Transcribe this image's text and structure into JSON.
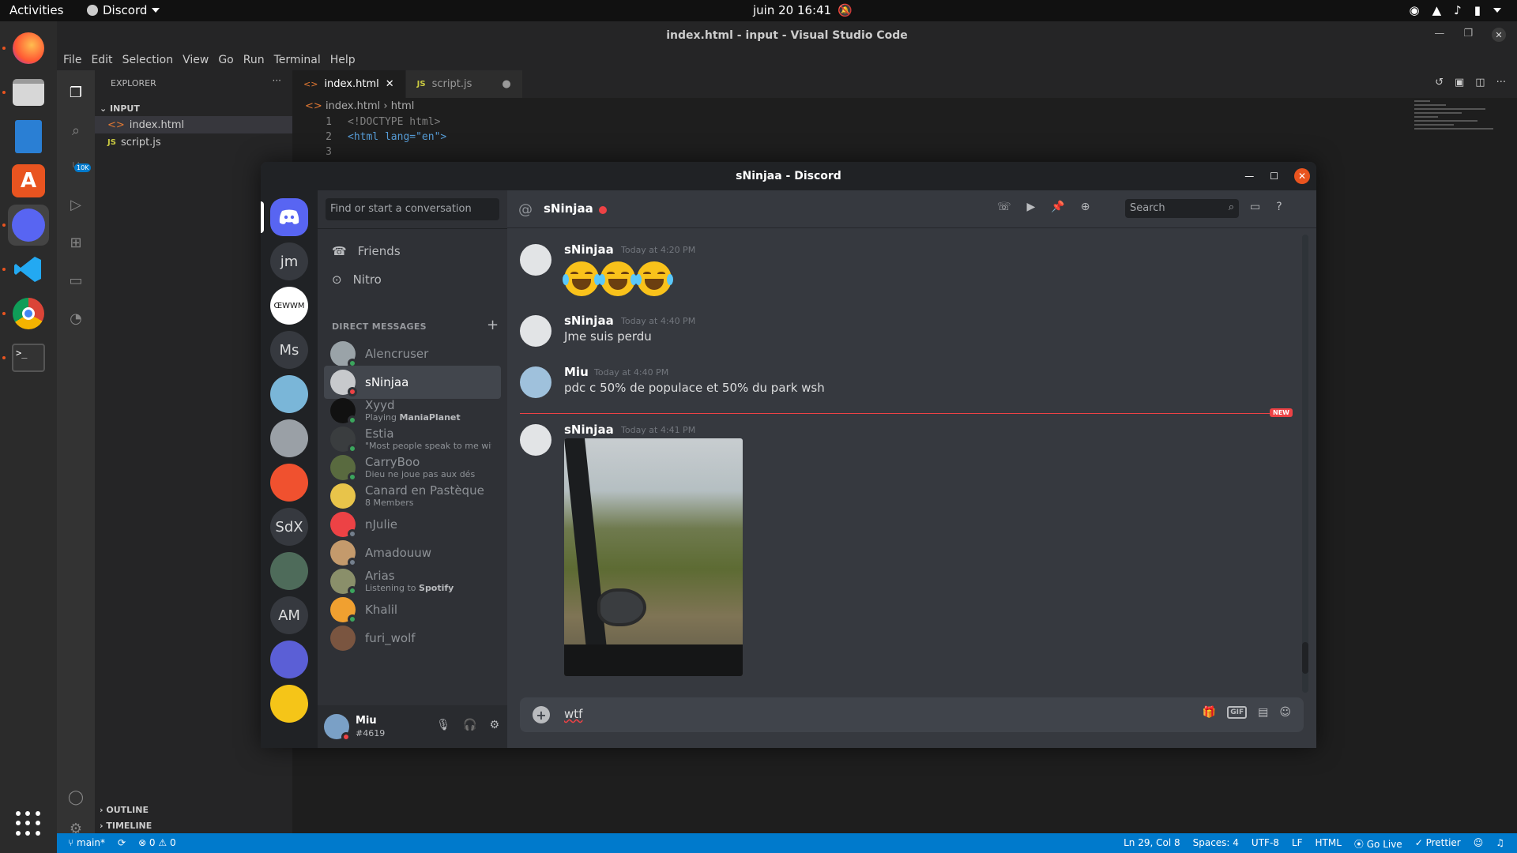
{
  "topbar": {
    "activities": "Activities",
    "app_name": "Discord",
    "clock": "juin 20  16:41"
  },
  "dock": {
    "apps": [
      "Firefox",
      "Files",
      "LibreOffice Writer",
      "Ubuntu Software",
      "Discord",
      "Visual Studio Code",
      "Google Chrome",
      "Terminal"
    ],
    "active": "Discord"
  },
  "vscode": {
    "title": "index.html - input - Visual Studio Code",
    "menu": [
      "File",
      "Edit",
      "Selection",
      "View",
      "Go",
      "Run",
      "Terminal",
      "Help"
    ],
    "explorer_label": "EXPLORER",
    "folder": "INPUT",
    "files": [
      "index.html",
      "script.js"
    ],
    "tabs": [
      {
        "label": "index.html",
        "icon": "html-icon",
        "active": true
      },
      {
        "label": "script.js",
        "icon": "js-icon",
        "active": false
      }
    ],
    "breadcrumb": [
      "index.html",
      "html"
    ],
    "code_lines": [
      {
        "num": "1",
        "text": "<!DOCTYPE html>"
      },
      {
        "num": "2",
        "text": "<html lang=\"en\">"
      },
      {
        "num": "3",
        "text": ""
      }
    ],
    "scm_badge": "10K",
    "outline": "OUTLINE",
    "timeline": "TIMELINE",
    "status": {
      "branch": "main*",
      "problems": "⊗ 0 ⚠ 0",
      "position": "Ln 29, Col 8",
      "spaces": "Spaces: 4",
      "encoding": "UTF-8",
      "eol": "LF",
      "language": "HTML",
      "golive": "Go Live",
      "prettier": "Prettier"
    }
  },
  "discord": {
    "window_title": "sNinjaa - Discord",
    "search_placeholder": "Find or start a conversation",
    "nav": [
      {
        "label": "Friends",
        "icon": "friends-icon"
      },
      {
        "label": "Nitro",
        "icon": "nitro-icon"
      }
    ],
    "dm_header": "DIRECT MESSAGES",
    "guilds": [
      "jm",
      "ŒWWM",
      "Ms",
      "",
      "",
      "",
      "SdX",
      "",
      "AM",
      "",
      ""
    ],
    "dms": [
      {
        "name": "Alencruser",
        "sub": "",
        "sub_bold": "",
        "status": "#3ba55d",
        "avatar": "#9aa3a8"
      },
      {
        "name": "sNinjaa",
        "sub": "",
        "sub_bold": "",
        "status": "#ed4245",
        "avatar": "#c7c9cc",
        "selected": true
      },
      {
        "name": "Xyyd",
        "sub": "Playing ",
        "sub_bold": "ManiaPlanet",
        "status": "#3ba55d",
        "avatar": "#111111"
      },
      {
        "name": "Estia",
        "sub": "\"Most people speak to me wit...",
        "sub_bold": "",
        "status": "#3ba55d",
        "avatar": "#3a3d3f"
      },
      {
        "name": "CarryBoo",
        "sub": "Dieu ne joue pas aux dés",
        "sub_bold": "",
        "status": "#3ba55d",
        "avatar": "#596a3f"
      },
      {
        "name": "Canard en Pastèque",
        "sub": "8 Members",
        "sub_bold": "",
        "status": "",
        "avatar": "#e8c44a"
      },
      {
        "name": "nJulie",
        "sub": "",
        "sub_bold": "",
        "status": "#747f8d",
        "avatar": "#ed4245"
      },
      {
        "name": "Amadouuw",
        "sub": "",
        "sub_bold": "",
        "status": "#747f8d",
        "avatar": "#c49a6c"
      },
      {
        "name": "Arias",
        "sub": "Listening to ",
        "sub_bold": "Spotify",
        "status": "#3ba55d",
        "avatar": "#8a8f6a"
      },
      {
        "name": "Khalil",
        "sub": "",
        "sub_bold": "",
        "status": "#3ba55d",
        "avatar": "#f0a030"
      },
      {
        "name": "furi_wolf",
        "sub": "",
        "sub_bold": "",
        "status": "",
        "avatar": "#7a5540"
      }
    ],
    "user": {
      "name": "Miu",
      "tag": "#4619"
    },
    "chat": {
      "recipient": "sNinjaa",
      "search": "Search",
      "messages": [
        {
          "author": "sNinjaa",
          "time": "Today at 4:20 PM",
          "text": "",
          "kind": "emoji",
          "emoji": "😂😂😂"
        },
        {
          "author": "sNinjaa",
          "time": "Today at 4:40 PM",
          "text": "Jme suis perdu",
          "kind": "text"
        },
        {
          "author": "Miu",
          "time": "Today at 4:40 PM",
          "text": "pdc c 50% de populace et 50% du park wsh",
          "kind": "text"
        },
        {
          "author": "sNinjaa",
          "time": "Today at 4:41 PM",
          "text": "",
          "kind": "image"
        }
      ],
      "new_label": "NEW",
      "composer_text": "wtf"
    }
  }
}
